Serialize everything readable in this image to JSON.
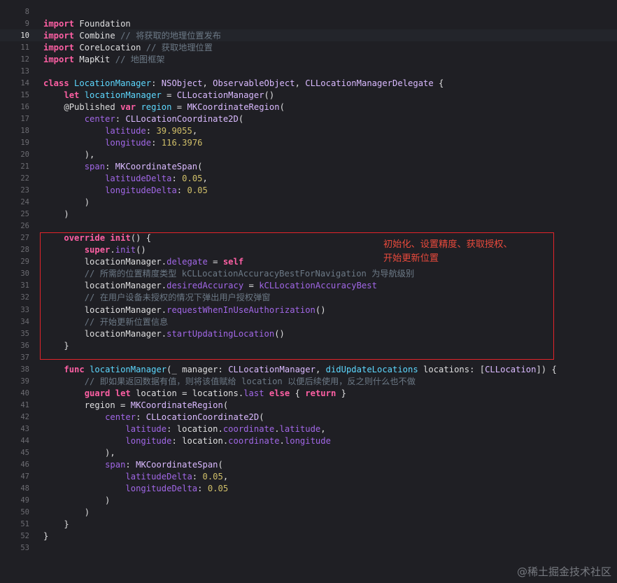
{
  "colors": {
    "background": "#1f1f24",
    "keyword": "#fc5fa3",
    "type": "#dabaff",
    "declaration": "#5dd8ff",
    "function": "#a167e6",
    "number": "#d0bf69",
    "comment": "#6c7986",
    "annotation": "#e2242a"
  },
  "editor": {
    "current_line": 10,
    "lines": [
      {
        "n": "8",
        "t": []
      },
      {
        "n": "9",
        "t": [
          [
            "kw",
            "import"
          ],
          [
            "plain",
            " Foundation"
          ]
        ]
      },
      {
        "n": "10",
        "t": [
          [
            "kw",
            "import"
          ],
          [
            "plain",
            " Combine "
          ],
          [
            "comment",
            "// 将获取的地理位置发布"
          ]
        ]
      },
      {
        "n": "11",
        "t": [
          [
            "kw",
            "import"
          ],
          [
            "plain",
            " CoreLocation "
          ],
          [
            "comment",
            "// 获取地理位置"
          ]
        ]
      },
      {
        "n": "12",
        "t": [
          [
            "kw",
            "import"
          ],
          [
            "plain",
            " MapKit "
          ],
          [
            "comment",
            "// 地图框架"
          ]
        ]
      },
      {
        "n": "13",
        "t": []
      },
      {
        "n": "14",
        "t": [
          [
            "kw",
            "class"
          ],
          [
            "plain",
            " "
          ],
          [
            "def",
            "LocationManager"
          ],
          [
            "plain",
            ": "
          ],
          [
            "type",
            "NSObject"
          ],
          [
            "plain",
            ", "
          ],
          [
            "type",
            "ObservableObject"
          ],
          [
            "plain",
            ", "
          ],
          [
            "type",
            "CLLocationManagerDelegate"
          ],
          [
            "plain",
            " {"
          ]
        ]
      },
      {
        "n": "15",
        "t": [
          [
            "plain",
            "    "
          ],
          [
            "kw",
            "let"
          ],
          [
            "plain",
            " "
          ],
          [
            "def",
            "locationManager"
          ],
          [
            "plain",
            " = "
          ],
          [
            "type",
            "CLLocationManager"
          ],
          [
            "plain",
            "()"
          ]
        ]
      },
      {
        "n": "16",
        "t": [
          [
            "plain",
            "    "
          ],
          [
            "attr",
            "@Published"
          ],
          [
            "plain",
            " "
          ],
          [
            "kw",
            "var"
          ],
          [
            "plain",
            " "
          ],
          [
            "def",
            "region"
          ],
          [
            "plain",
            " = "
          ],
          [
            "type",
            "MKCoordinateRegion"
          ],
          [
            "plain",
            "("
          ]
        ]
      },
      {
        "n": "17",
        "t": [
          [
            "plain",
            "        "
          ],
          [
            "fn",
            "center"
          ],
          [
            "plain",
            ": "
          ],
          [
            "type",
            "CLLocationCoordinate2D"
          ],
          [
            "plain",
            "("
          ]
        ]
      },
      {
        "n": "18",
        "t": [
          [
            "plain",
            "            "
          ],
          [
            "fn",
            "latitude"
          ],
          [
            "plain",
            ": "
          ],
          [
            "num",
            "39.9055"
          ],
          [
            "plain",
            ","
          ]
        ]
      },
      {
        "n": "19",
        "t": [
          [
            "plain",
            "            "
          ],
          [
            "fn",
            "longitude"
          ],
          [
            "plain",
            ": "
          ],
          [
            "num",
            "116.3976"
          ]
        ]
      },
      {
        "n": "20",
        "t": [
          [
            "plain",
            "        ),"
          ]
        ]
      },
      {
        "n": "21",
        "t": [
          [
            "plain",
            "        "
          ],
          [
            "fn",
            "span"
          ],
          [
            "plain",
            ": "
          ],
          [
            "type",
            "MKCoordinateSpan"
          ],
          [
            "plain",
            "("
          ]
        ]
      },
      {
        "n": "22",
        "t": [
          [
            "plain",
            "            "
          ],
          [
            "fn",
            "latitudeDelta"
          ],
          [
            "plain",
            ": "
          ],
          [
            "num",
            "0.05"
          ],
          [
            "plain",
            ","
          ]
        ]
      },
      {
        "n": "23",
        "t": [
          [
            "plain",
            "            "
          ],
          [
            "fn",
            "longitudeDelta"
          ],
          [
            "plain",
            ": "
          ],
          [
            "num",
            "0.05"
          ]
        ]
      },
      {
        "n": "24",
        "t": [
          [
            "plain",
            "        )"
          ]
        ]
      },
      {
        "n": "25",
        "t": [
          [
            "plain",
            "    )"
          ]
        ]
      },
      {
        "n": "26",
        "t": []
      },
      {
        "n": "27",
        "t": [
          [
            "plain",
            "    "
          ],
          [
            "kw",
            "override"
          ],
          [
            "plain",
            " "
          ],
          [
            "kw",
            "init"
          ],
          [
            "plain",
            "() {"
          ]
        ]
      },
      {
        "n": "28",
        "t": [
          [
            "plain",
            "        "
          ],
          [
            "kw",
            "super"
          ],
          [
            "plain",
            "."
          ],
          [
            "fn",
            "init"
          ],
          [
            "plain",
            "()"
          ]
        ]
      },
      {
        "n": "29",
        "t": [
          [
            "plain",
            "        locationManager."
          ],
          [
            "fn",
            "delegate"
          ],
          [
            "plain",
            " = "
          ],
          [
            "kw",
            "self"
          ]
        ]
      },
      {
        "n": "30",
        "t": [
          [
            "plain",
            "        "
          ],
          [
            "comment",
            "// 所需的位置精度类型 kCLLocationAccuracyBestForNavigation 为导航级别"
          ]
        ]
      },
      {
        "n": "31",
        "t": [
          [
            "plain",
            "        locationManager."
          ],
          [
            "fn",
            "desiredAccuracy"
          ],
          [
            "plain",
            " = "
          ],
          [
            "fn",
            "kCLLocationAccuracyBest"
          ]
        ]
      },
      {
        "n": "32",
        "t": [
          [
            "plain",
            "        "
          ],
          [
            "comment",
            "// 在用户设备未授权的情况下弹出用户授权弹窗"
          ]
        ]
      },
      {
        "n": "33",
        "t": [
          [
            "plain",
            "        locationManager."
          ],
          [
            "fn",
            "requestWhenInUseAuthorization"
          ],
          [
            "plain",
            "()"
          ]
        ]
      },
      {
        "n": "34",
        "t": [
          [
            "plain",
            "        "
          ],
          [
            "comment",
            "// 开始更新位置信息"
          ]
        ]
      },
      {
        "n": "35",
        "t": [
          [
            "plain",
            "        locationManager."
          ],
          [
            "fn",
            "startUpdatingLocation"
          ],
          [
            "plain",
            "()"
          ]
        ]
      },
      {
        "n": "36",
        "t": [
          [
            "plain",
            "    }"
          ]
        ]
      },
      {
        "n": "37",
        "t": []
      },
      {
        "n": "38",
        "t": [
          [
            "plain",
            "    "
          ],
          [
            "kw",
            "func"
          ],
          [
            "plain",
            " "
          ],
          [
            "def",
            "locationManager"
          ],
          [
            "plain",
            "(_ manager: "
          ],
          [
            "type",
            "CLLocationManager"
          ],
          [
            "plain",
            ", "
          ],
          [
            "def",
            "didUpdateLocations"
          ],
          [
            "plain",
            " locations: ["
          ],
          [
            "type",
            "CLLocation"
          ],
          [
            "plain",
            "]) {"
          ]
        ]
      },
      {
        "n": "39",
        "t": [
          [
            "plain",
            "        "
          ],
          [
            "comment",
            "// 即如果返回数据有值，则将该值赋给 location 以便后续使用，反之则什么也不做"
          ]
        ]
      },
      {
        "n": "40",
        "t": [
          [
            "plain",
            "        "
          ],
          [
            "kw",
            "guard"
          ],
          [
            "plain",
            " "
          ],
          [
            "kw",
            "let"
          ],
          [
            "plain",
            " location = locations."
          ],
          [
            "fn",
            "last"
          ],
          [
            "plain",
            " "
          ],
          [
            "kw",
            "else"
          ],
          [
            "plain",
            " { "
          ],
          [
            "kw",
            "return"
          ],
          [
            "plain",
            " }"
          ]
        ]
      },
      {
        "n": "41",
        "t": [
          [
            "plain",
            "        region = "
          ],
          [
            "type",
            "MKCoordinateRegion"
          ],
          [
            "plain",
            "("
          ]
        ]
      },
      {
        "n": "42",
        "t": [
          [
            "plain",
            "            "
          ],
          [
            "fn",
            "center"
          ],
          [
            "plain",
            ": "
          ],
          [
            "type",
            "CLLocationCoordinate2D"
          ],
          [
            "plain",
            "("
          ]
        ]
      },
      {
        "n": "43",
        "t": [
          [
            "plain",
            "                "
          ],
          [
            "fn",
            "latitude"
          ],
          [
            "plain",
            ": location."
          ],
          [
            "fn",
            "coordinate"
          ],
          [
            "plain",
            "."
          ],
          [
            "fn",
            "latitude"
          ],
          [
            "plain",
            ","
          ]
        ]
      },
      {
        "n": "44",
        "t": [
          [
            "plain",
            "                "
          ],
          [
            "fn",
            "longitude"
          ],
          [
            "plain",
            ": location."
          ],
          [
            "fn",
            "coordinate"
          ],
          [
            "plain",
            "."
          ],
          [
            "fn",
            "longitude"
          ]
        ]
      },
      {
        "n": "45",
        "t": [
          [
            "plain",
            "            ),"
          ]
        ]
      },
      {
        "n": "46",
        "t": [
          [
            "plain",
            "            "
          ],
          [
            "fn",
            "span"
          ],
          [
            "plain",
            ": "
          ],
          [
            "type",
            "MKCoordinateSpan"
          ],
          [
            "plain",
            "("
          ]
        ]
      },
      {
        "n": "47",
        "t": [
          [
            "plain",
            "                "
          ],
          [
            "fn",
            "latitudeDelta"
          ],
          [
            "plain",
            ": "
          ],
          [
            "num",
            "0.05"
          ],
          [
            "plain",
            ","
          ]
        ]
      },
      {
        "n": "48",
        "t": [
          [
            "plain",
            "                "
          ],
          [
            "fn",
            "longitudeDelta"
          ],
          [
            "plain",
            ": "
          ],
          [
            "num",
            "0.05"
          ]
        ]
      },
      {
        "n": "49",
        "t": [
          [
            "plain",
            "            )"
          ]
        ]
      },
      {
        "n": "50",
        "t": [
          [
            "plain",
            "        )"
          ]
        ]
      },
      {
        "n": "51",
        "t": [
          [
            "plain",
            "    }"
          ]
        ]
      },
      {
        "n": "52",
        "t": [
          [
            "plain",
            "}"
          ]
        ]
      },
      {
        "n": "53",
        "t": []
      }
    ]
  },
  "annotation": {
    "line1": "初始化、设置精度、获取授权、",
    "line2": "开始更新位置"
  },
  "watermark": "@稀土掘金技术社区"
}
